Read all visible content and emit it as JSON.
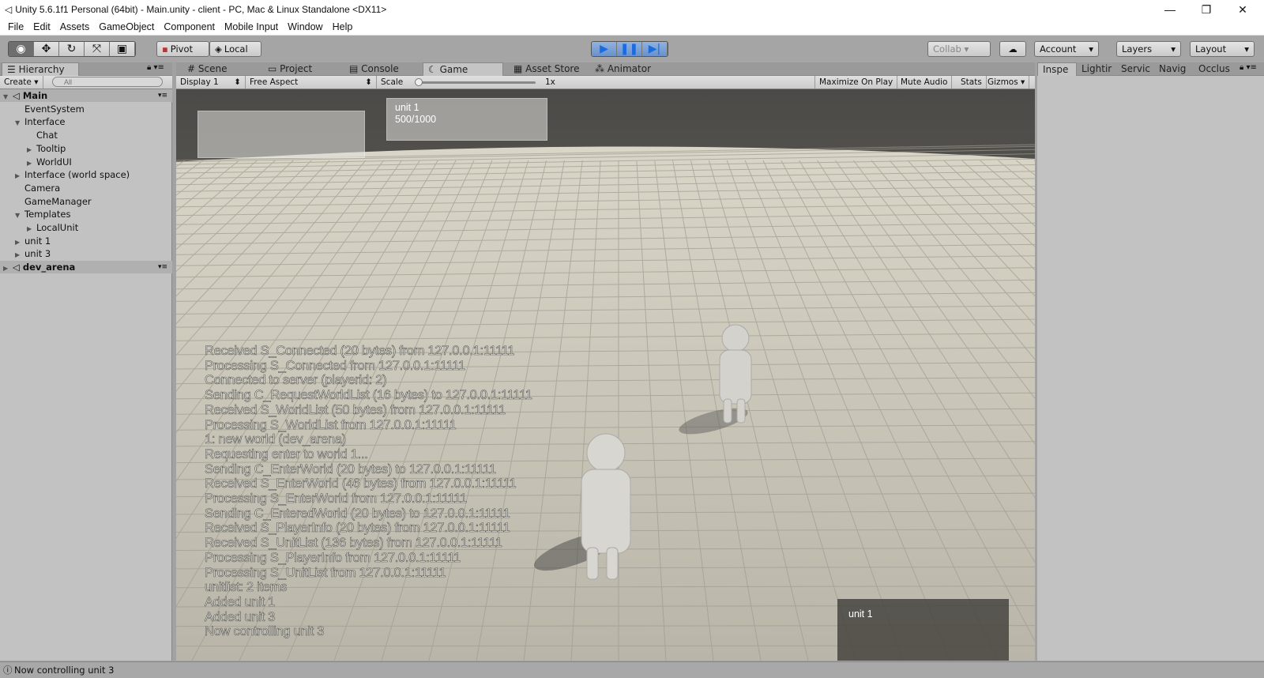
{
  "window": {
    "title": "Unity 5.6.1f1 Personal (64bit) - Main.unity - client - PC, Mac & Linux Standalone <DX11>",
    "controls": [
      "—",
      "❐",
      "✕"
    ]
  },
  "menu": [
    "File",
    "Edit",
    "Assets",
    "GameObject",
    "Component",
    "Mobile Input",
    "Window",
    "Help"
  ],
  "toolbar": {
    "tools": [
      "eye-icon",
      "move-icon",
      "rotate-icon",
      "scale-icon",
      "rect-icon"
    ],
    "pivot": "Pivot",
    "local": "Local",
    "collab": "Collab ▾",
    "account": "Account",
    "layers": "Layers",
    "layout": "Layout",
    "play_state": "playing"
  },
  "tabs": {
    "hierarchy": "Hierarchy",
    "scene": "Scene",
    "project": "Project",
    "console": "Console",
    "game": "Game",
    "asset_store": "Asset Store",
    "animator": "Animator"
  },
  "inspector_tabs": [
    "Inspe",
    "Lightir",
    "Servic",
    "Navig",
    "Occlus"
  ],
  "hierarchy": {
    "create": "Create",
    "search_placeholder": "All",
    "items": [
      {
        "label": "Main",
        "depth": 0,
        "arrow": "▼",
        "scene": true
      },
      {
        "label": "EventSystem",
        "depth": 1,
        "arrow": ""
      },
      {
        "label": "Interface",
        "depth": 1,
        "arrow": "▼"
      },
      {
        "label": "Chat",
        "depth": 2,
        "arrow": ""
      },
      {
        "label": "Tooltip",
        "depth": 2,
        "arrow": "▶"
      },
      {
        "label": "WorldUI",
        "depth": 2,
        "arrow": "▶"
      },
      {
        "label": "Interface (world space)",
        "depth": 1,
        "arrow": "▶"
      },
      {
        "label": "Camera",
        "depth": 1,
        "arrow": ""
      },
      {
        "label": "GameManager",
        "depth": 1,
        "arrow": ""
      },
      {
        "label": "Templates",
        "depth": 1,
        "arrow": "▼"
      },
      {
        "label": "LocalUnit",
        "depth": 2,
        "arrow": "▶"
      },
      {
        "label": "unit 1",
        "depth": 1,
        "arrow": "▶"
      },
      {
        "label": "unit 3",
        "depth": 1,
        "arrow": "▶"
      },
      {
        "label": "dev_arena",
        "depth": 0,
        "arrow": "▶",
        "scene": true
      }
    ]
  },
  "game_toolbar": {
    "display": "Display 1",
    "aspect": "Free Aspect",
    "scale_label": "Scale",
    "scale_value": "1x",
    "maximize": "Maximize On Play",
    "mute": "Mute Audio",
    "stats": "Stats",
    "gizmos": "Gizmos"
  },
  "game": {
    "unit_panel_name": "unit 1",
    "unit_panel_hp": "500/1000",
    "target_panel_name": "unit 1",
    "log": [
      "Received S_Connected (20 bytes) from 127.0.0.1:11111",
      "Processing S_Connected from 127.0.0.1:11111",
      "Connected to server (playerid: 2)",
      "Sending C_RequestWorldList (16 bytes) to 127.0.0.1:11111",
      "Received S_WorldList (50 bytes) from 127.0.0.1:11111",
      "Processing S_WorldList from 127.0.0.1:11111",
      "1: new world (dev_arena)",
      "Requesting enter to world 1...",
      "Sending C_EnterWorld (20 bytes) to 127.0.0.1:11111",
      "Received S_EnterWorld (46 bytes) from 127.0.0.1:11111",
      "Processing S_EnterWorld from 127.0.0.1:11111",
      "Sending C_EnteredWorld (20 bytes) to 127.0.0.1:11111",
      "Received S_PlayerInfo (20 bytes) from 127.0.0.1:11111",
      "Received S_UnitList (136 bytes) from 127.0.0.1:11111",
      "Processing S_PlayerInfo from 127.0.0.1:11111",
      "Processing S_UnitList from 127.0.0.1:11111",
      "unitlist: 2 items",
      "Added unit 1",
      "Added unit 3",
      "Now controlling unit 3"
    ]
  },
  "status": {
    "message": "Now controlling unit 3"
  }
}
